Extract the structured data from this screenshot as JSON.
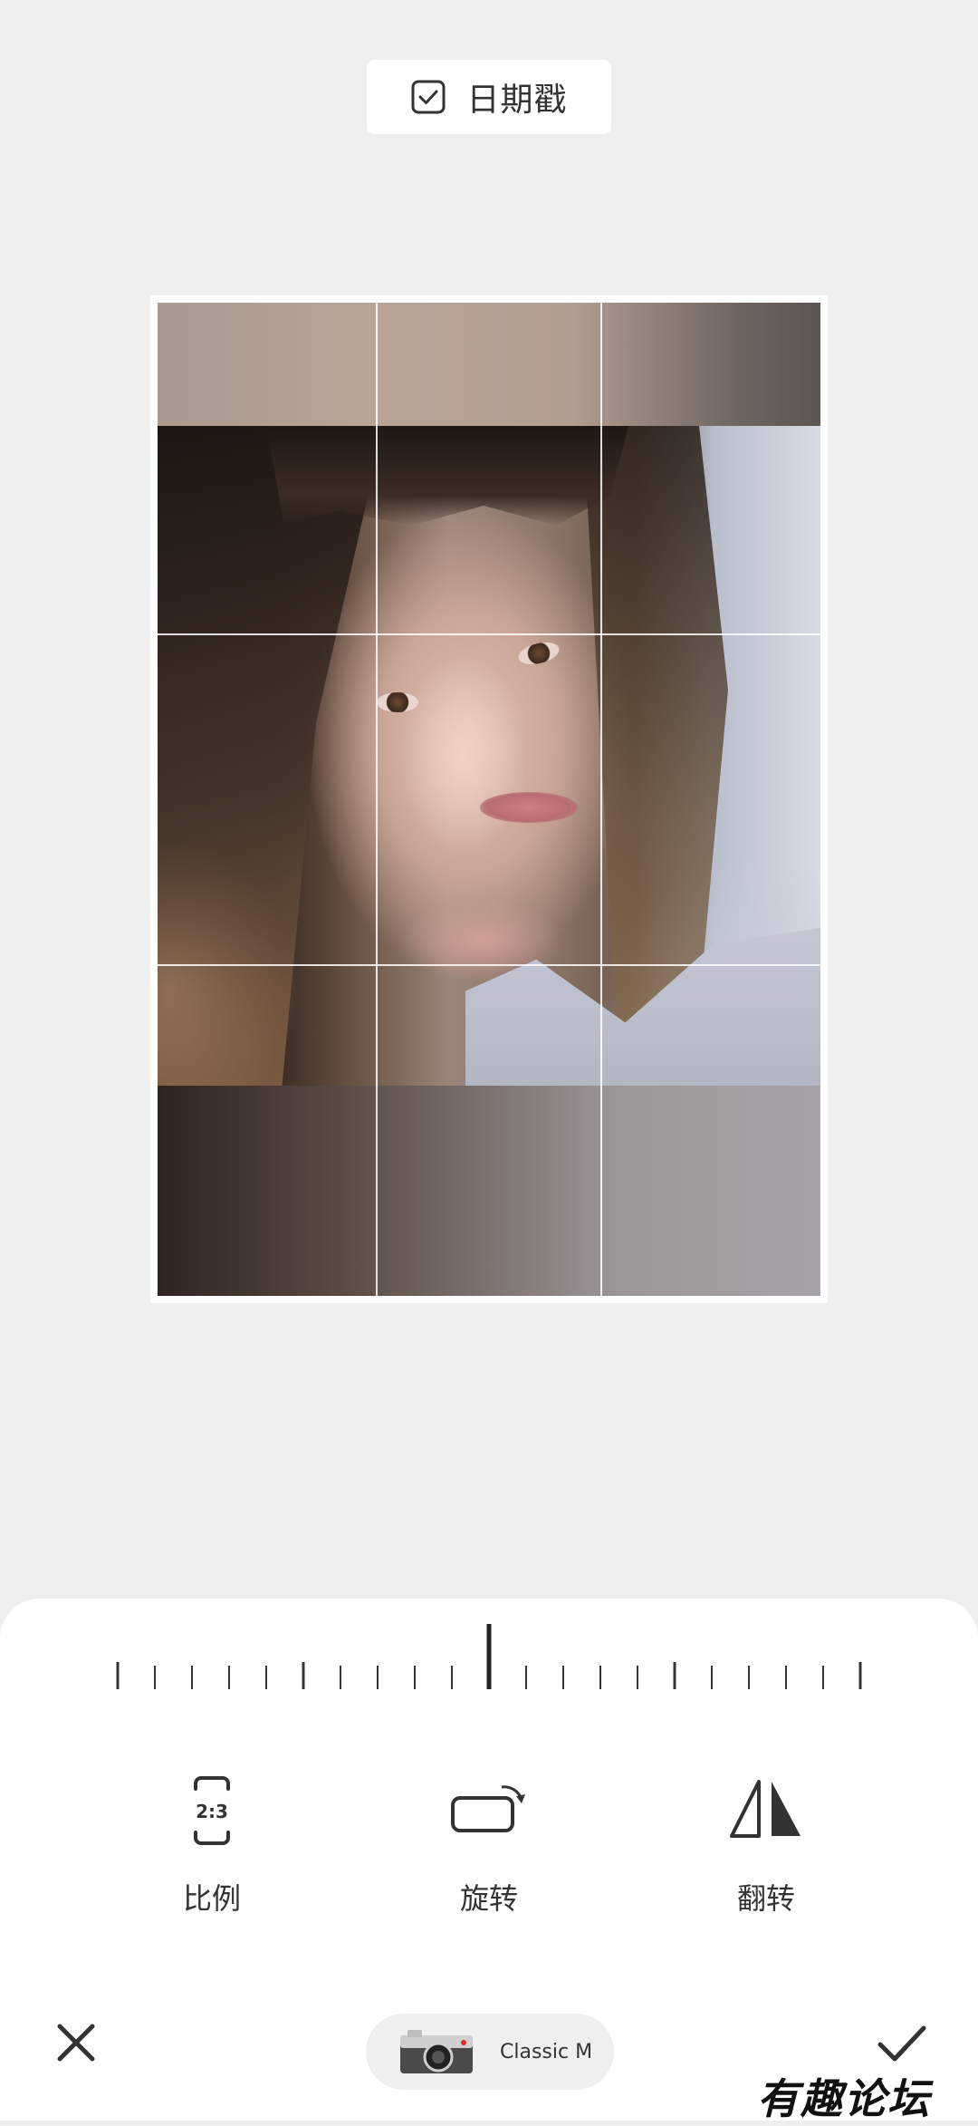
{
  "top": {
    "date_stamp_label": "日期戳",
    "date_stamp_checked": true
  },
  "editor": {
    "crop_grid": "3x3",
    "rotation_angle_degrees": 0
  },
  "tools": [
    {
      "label": "比例",
      "icon": "aspect-ratio-icon",
      "icon_text": "2:3"
    },
    {
      "label": "旋转",
      "icon": "rotate-icon"
    },
    {
      "label": "翻转",
      "icon": "flip-icon"
    }
  ],
  "bottom_bar": {
    "close_icon": "close-icon",
    "confirm_icon": "checkmark-icon",
    "camera_preset": "Classic M"
  },
  "watermark": "有趣论坛",
  "colors": {
    "background": "#efefef",
    "panel": "#ffffff",
    "text": "#333333",
    "chip": "#efefef"
  }
}
